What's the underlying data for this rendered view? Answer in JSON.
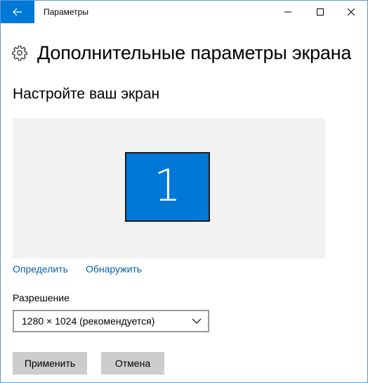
{
  "window": {
    "title": "Параметры",
    "controls": {
      "minimize_icon": "minimize-icon",
      "maximize_icon": "maximize-icon",
      "close_icon": "close-icon"
    },
    "back_icon": "back-arrow-icon"
  },
  "header": {
    "icon": "gear-icon",
    "title": "Дополнительные параметры экрана"
  },
  "section": {
    "title": "Настройте ваш экран"
  },
  "display_preview": {
    "monitor_number": "1"
  },
  "links": {
    "identify": "Определить",
    "detect": "Обнаружить"
  },
  "resolution": {
    "label": "Разрешение",
    "selected": "1280 × 1024 (рекомендуется)"
  },
  "buttons": {
    "apply": "Применить",
    "cancel": "Отмена"
  },
  "colors": {
    "accent": "#0078d7",
    "link": "#0063b1",
    "button_bg": "#cccccc",
    "preview_bg": "#f2f2f2"
  }
}
